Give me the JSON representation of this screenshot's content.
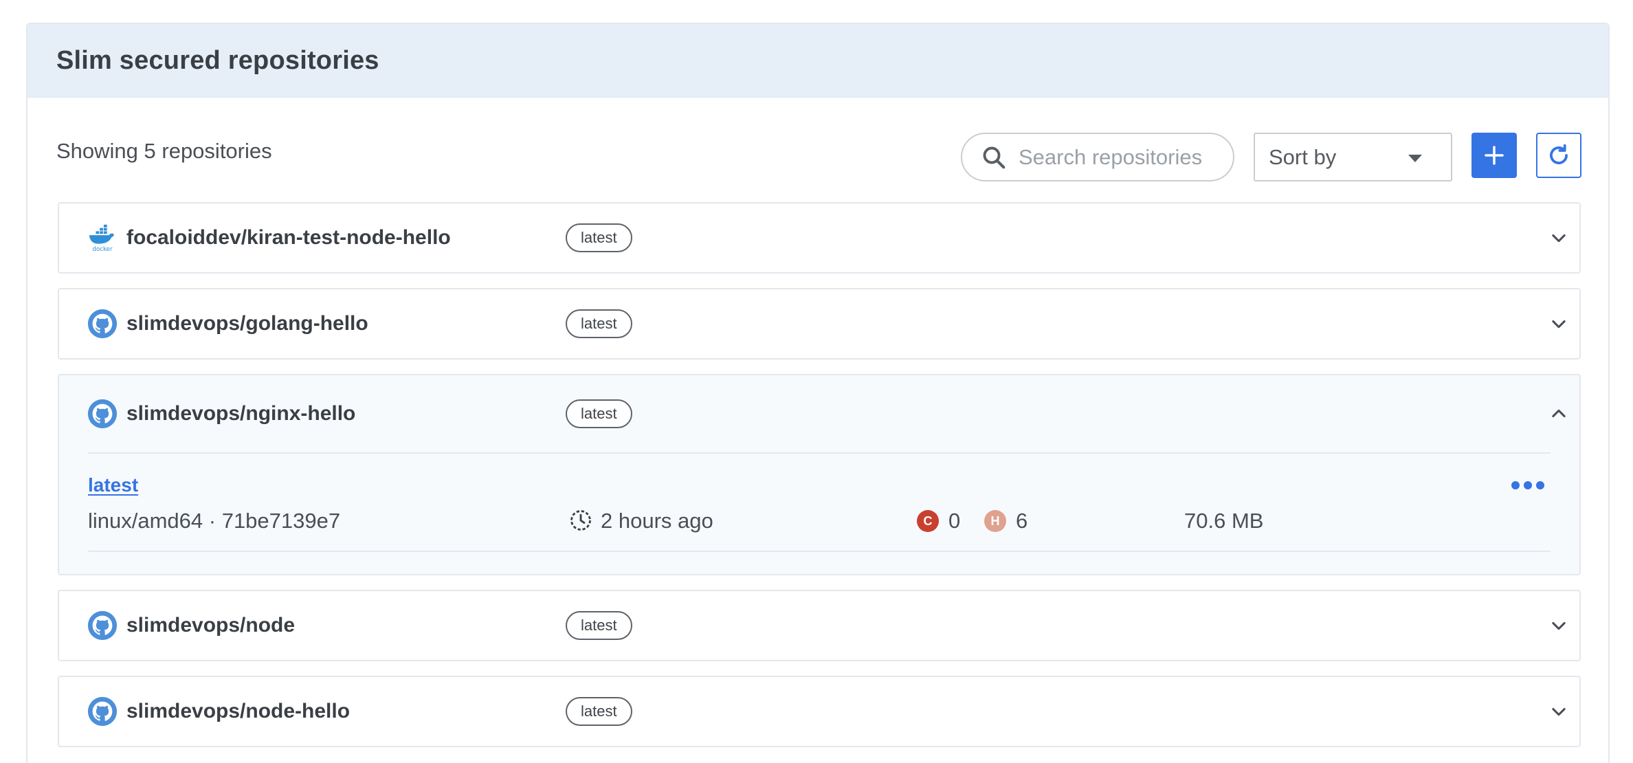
{
  "panel": {
    "title": "Slim secured repositories"
  },
  "toolbar": {
    "count_text": "Showing 5 repositories",
    "search_placeholder": "Search repositories",
    "sort_label": "Sort by",
    "icons": {
      "search": "search-icon",
      "add": "plus-icon",
      "refresh": "refresh-icon"
    }
  },
  "colors": {
    "accent": "#3574e3",
    "header_bg": "#e6eff8",
    "critical": "#c8412f",
    "high": "#e0a18e"
  },
  "repos": [
    {
      "name": "focaloiddev/kiran-test-node-hello",
      "tag": "latest",
      "source_icon": "docker-icon",
      "expanded": false
    },
    {
      "name": "slimdevops/golang-hello",
      "tag": "latest",
      "source_icon": "github-icon",
      "expanded": false
    },
    {
      "name": "slimdevops/nginx-hello",
      "tag": "latest",
      "source_icon": "github-icon",
      "expanded": true,
      "detail": {
        "tag": "latest",
        "platform": "linux/amd64 · 71be7139e7",
        "time": "2 hours ago",
        "critical_label": "C",
        "critical_count": "0",
        "high_label": "H",
        "high_count": "6",
        "size": "70.6 MB"
      }
    },
    {
      "name": "slimdevops/node",
      "tag": "latest",
      "source_icon": "github-icon",
      "expanded": false
    },
    {
      "name": "slimdevops/node-hello",
      "tag": "latest",
      "source_icon": "github-icon",
      "expanded": false
    }
  ]
}
